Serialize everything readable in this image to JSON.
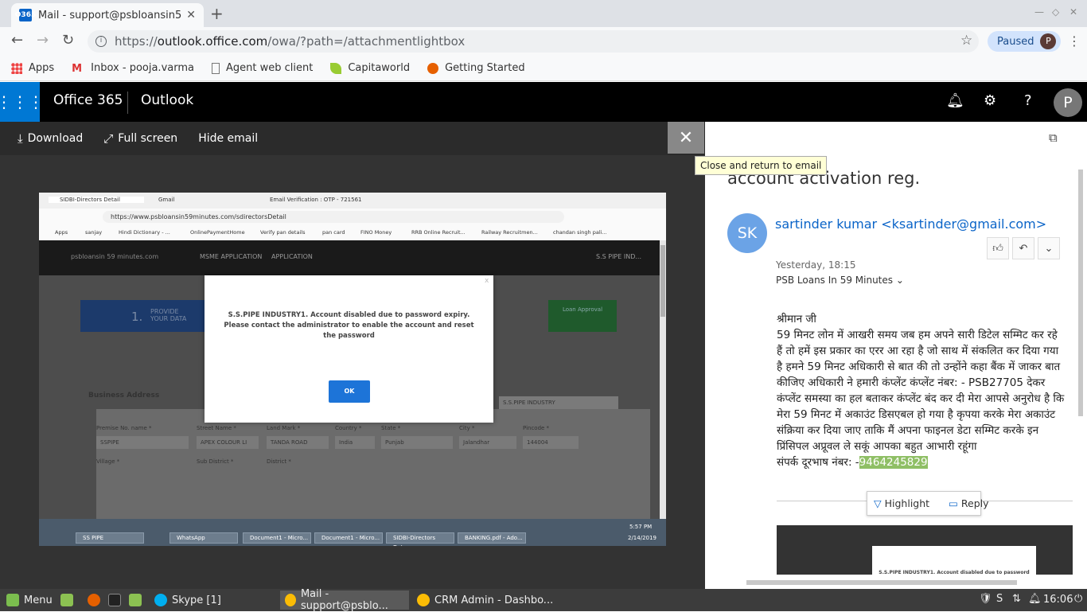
{
  "browser": {
    "tab_title": "Mail - support@psbloansin59m",
    "tab_icon": "O365",
    "url_prefix": "https://",
    "url_host": "outlook.office.com",
    "url_path": "/owa/?path=/attachmentlightbox",
    "profile_status": "Paused",
    "profile_initial": "P",
    "bookmarks": [
      "Apps",
      "Inbox - pooja.varma",
      "Agent web client",
      "Capitaworld",
      "Getting Started"
    ]
  },
  "o365": {
    "brand": "Office 365",
    "app": "Outlook",
    "user_initial": "P"
  },
  "lightbox": {
    "download": "Download",
    "fullscreen": "Full screen",
    "hide_email": "Hide email",
    "close_tooltip": "Close and return to email"
  },
  "attachment": {
    "tabs": [
      "SIDBI-Directors Detail",
      "Gmail",
      "Email Verification : OTP - 721561"
    ],
    "url": "https://www.psbloansin59minutes.com/sdirectorsDetail",
    "bookmarks": [
      "Apps",
      "sanjay",
      "Hindi Dictionary - ...",
      "OnlinePaymentHome",
      "Verify pan details",
      "pan card",
      "FINO Money",
      "RRB Online Recruit...",
      "Railway Recruitmen...",
      "chandan singh pali..."
    ],
    "site_logo": "psbloansin 59 minutes.com",
    "nav_items": [
      "MSME APPLICATION",
      "APPLICATION",
      "S.S PIPE IND..."
    ],
    "step_number": "1.",
    "step_label": "PROVIDE YOUR DATA",
    "step_last": "Loan Approval",
    "modal_message": "S.S.PIPE INDUSTRY1. Account disabled due to password expiry. Please contact the administrator to enable the account and reset the password",
    "modal_ok": "OK",
    "section": "Business Address",
    "company_field": "S.S.PIPE INDUSTRY",
    "form_labels": [
      "Premise No. name *",
      "Street Name *",
      "Land Mark *",
      "Country *",
      "State *",
      "City *",
      "Pincode *",
      "Village *",
      "Sub District *",
      "District *"
    ],
    "form_values": [
      "SSPIPE",
      "APEX COLOUR LI",
      "TANDA ROAD",
      "India",
      "Punjab",
      "Jalandhar",
      "144004"
    ],
    "taskbar_items": [
      "SS PIPE",
      "WhatsApp",
      "Document1 - Micro...",
      "Document1 - Micro...",
      "SIDBI-Directors Deta...",
      "BANKING.pdf - Ado..."
    ],
    "time": "5:57 PM",
    "date": "2/14/2019"
  },
  "email": {
    "subject": "account activation reg.",
    "sender_initials": "SK",
    "sender": "sartinder kumar <ksartinder@gmail.com>",
    "date": "Yesterday, 18:15",
    "to": "PSB Loans In 59 Minutes",
    "greeting": "श्रीमान जी",
    "body": "59 मिनट लोन में आखरी समय जब हम अपने सारी डिटेल सम्मिट कर रहे हैं तो हमें इस प्रकार का एरर आ रहा है जो साथ में संकलित कर दिया गया है हमने 59 मिनट अधिकारी से बात की तो उन्होंने कहा बैंक में जाकर बात कीजिए अधिकारी ने हमारी कंप्लेंट कंप्लेंट नंबर: - PSB27705 देकर कंप्लेंट समस्या का हल बताकर कंप्लेंट बंद कर दी मेरा आपसे अनुरोध है कि मेरा 59 मिनट में अकाउंट डिसएबल हो गया है कृपया करके मेरा अकाउंट संक्रिया कर दिया जाए ताकि मैं अपना फाइनल डेटा सम्मिट करके इन प्रिंसिपल अप्रूवल ले सकूं आपका बहुत आभारी रहूंगा",
    "phone_label": "संपर्क दूरभाष नंबर: -",
    "phone": "9464245829",
    "highlight": "Highlight",
    "reply": "Reply",
    "thumb_text": "S.S.PIPE INDUSTRY1. Account disabled due to password expiry."
  },
  "taskbar": {
    "menu": "Menu",
    "skype": "Skype [1]",
    "mail": "Mail - support@psblo...",
    "crm": "CRM Admin - Dashbo...",
    "clock": "16:06"
  }
}
